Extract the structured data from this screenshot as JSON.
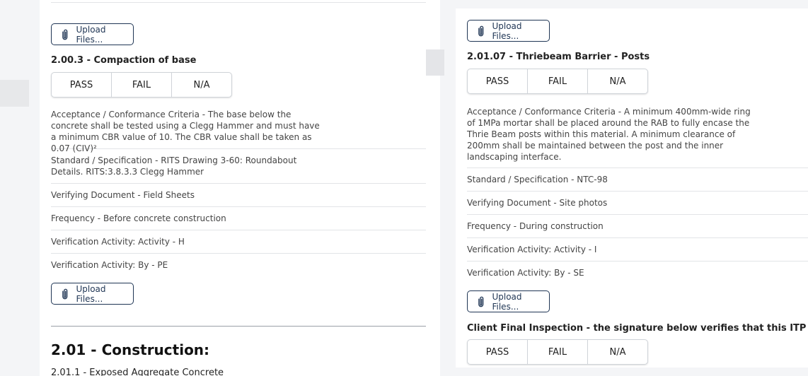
{
  "upload_label": "Upload Files...",
  "options": {
    "pass": "PASS",
    "fail": "FAIL",
    "na": "N/A"
  },
  "left": {
    "item_heading": "2.00.3 - Compaction of base",
    "acceptance": "Acceptance / Conformance Criteria - The base below the concrete shall be tested using a Clegg Hammer and must have a minimum CBR value of 10. The CBR value shall be taken as 0.07 (CIV)²",
    "standard": "Standard / Specification - RITS Drawing 3-60: Roundabout Details. RITS:3.8.3.3 Clegg Hammer",
    "verifying_document": "Verifying Document - Field Sheets",
    "frequency": "Frequency - Before concrete construction",
    "activity": "Verification Activity: Activity - H",
    "by": "Verification Activity: By - PE",
    "section_title": "2.01 - Construction:",
    "next_item": "2.01.1 - Exposed Aggregate Concrete"
  },
  "right": {
    "item_heading": "2.01.07 - Thriebeam Barrier - Posts",
    "acceptance": "Acceptance / Conformance Criteria - A minimum 400mm-wide ring of 1MPa mortar shall be placed around the RAB to fully encase the Thrie Beam posts within this material. A minimum clearance of 200mm shall be maintained between the post and the inner landscaping interface.",
    "standard": "Standard / Specification - NTC-98",
    "verifying_document": "Verifying Document - Site photos",
    "frequency": "Frequency - During construction",
    "activity": "Verification Activity: Activity - I",
    "by": "Verification Activity: By - SE",
    "client_final": "Client Final Inspection - the signature below verifies that this ITP has been co"
  },
  "colors": {
    "accent": "#1f3554",
    "border": "#cfd3d8",
    "background": "#f4f5f7"
  }
}
